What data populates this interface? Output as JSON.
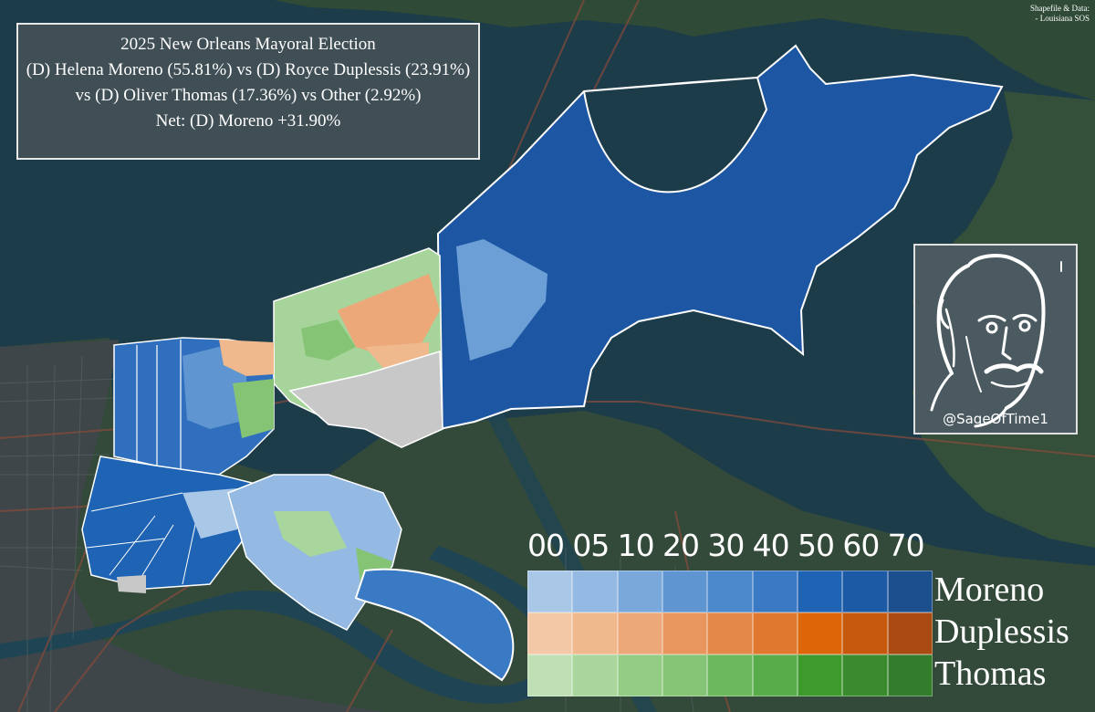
{
  "title": {
    "line1": "2025 New Orleans Mayoral Election",
    "line2": "(D) Helena Moreno (55.81%) vs (D) Royce Duplessis (23.91%)",
    "line3": "vs (D) Oliver Thomas (17.36%) vs Other (2.92%)",
    "line4": "Net: (D) Moreno +31.90%"
  },
  "credit": {
    "line1": "Shapefile & Data:",
    "line2": "- Louisiana SOS"
  },
  "author": {
    "handle": "@SageOfTime1"
  },
  "legend": {
    "scale": [
      "00",
      "05",
      "10",
      "20",
      "30",
      "40",
      "50",
      "60",
      "70"
    ],
    "candidates": [
      {
        "name": "Moreno",
        "colors": [
          "#a9c8e8",
          "#94b9e2",
          "#7aa8da",
          "#5f95d1",
          "#4c88cc",
          "#3a79c4",
          "#1f63b5",
          "#1d5aa5",
          "#1b4f8e"
        ]
      },
      {
        "name": "Duplessis",
        "colors": [
          "#f2c8a6",
          "#f0b88d",
          "#eca878",
          "#e8965d",
          "#e48848",
          "#e0782f",
          "#dc6608",
          "#c7590f",
          "#a84a12"
        ]
      },
      {
        "name": "Thomas",
        "colors": [
          "#bfe0b5",
          "#a8d69c",
          "#94cc85",
          "#85c474",
          "#6bb85d",
          "#58ac4a",
          "#3f9a2e",
          "#3a8a2e",
          "#327c2c"
        ]
      }
    ]
  },
  "colors": {
    "water": "#1d3c4a",
    "land": "#2f4634",
    "city": "#3a4448",
    "no_data": "#c8c8c8"
  }
}
